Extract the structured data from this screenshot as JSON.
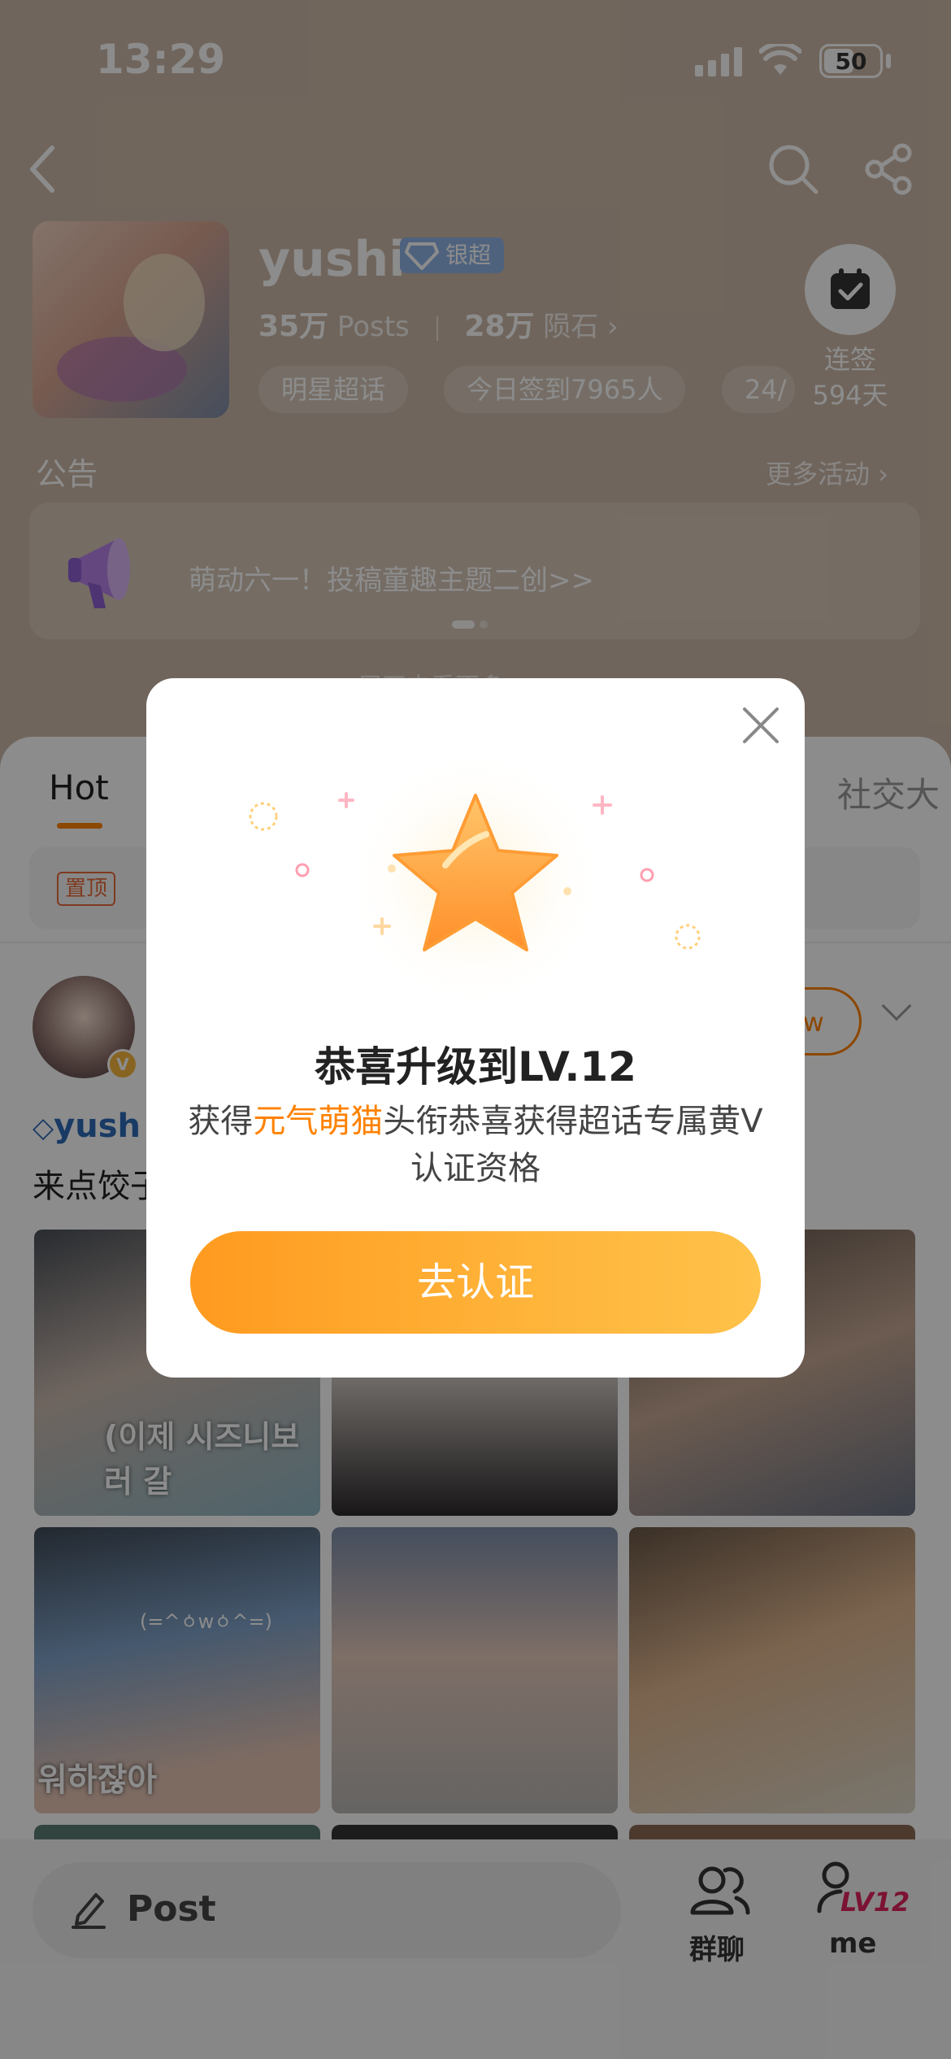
{
  "status_bar": {
    "time": "13:29",
    "battery": "50"
  },
  "header": {
    "name": "yushi",
    "rank_badge": "银超",
    "posts_count": "35万",
    "posts_label": "Posts",
    "meteor_count": "28万",
    "meteor_label": "陨石",
    "chips": [
      "明星超话",
      "今日签到7965人",
      "24/"
    ],
    "checkin_label_1": "连签",
    "checkin_label_2": "594天"
  },
  "notice": {
    "title": "公告",
    "more_activity": "更多活动",
    "text": "萌动六一！投稿童趣主题二创>>",
    "faint_link": "展开查看更多"
  },
  "tabs": {
    "hot": "Hot",
    "social": "社交大"
  },
  "feed": {
    "pinned_tag": "置顶",
    "follow": "ow",
    "post_user": "yush",
    "post_text": "来点饺子",
    "photo_captions": [
      "(이제 시즈니보러 갈",
      "워하잖아"
    ],
    "photo_subcaption": "(=^ㆁwㆁ^=)"
  },
  "bottom_bar": {
    "post_label": "Post",
    "group_chat_label": "群聊",
    "me_label": "me",
    "level_badge": "LV12"
  },
  "modal": {
    "title": "恭喜升级到LV.12",
    "desc_prefix": "获得",
    "desc_highlight": "元气萌猫",
    "desc_suffix": "头衔恭喜获得超话专属黄V认证资格",
    "button": "去认证"
  },
  "colors": {
    "accent": "#ff8200",
    "link_blue": "#2d6bb7",
    "badge_silver": "#8fb3e6"
  }
}
